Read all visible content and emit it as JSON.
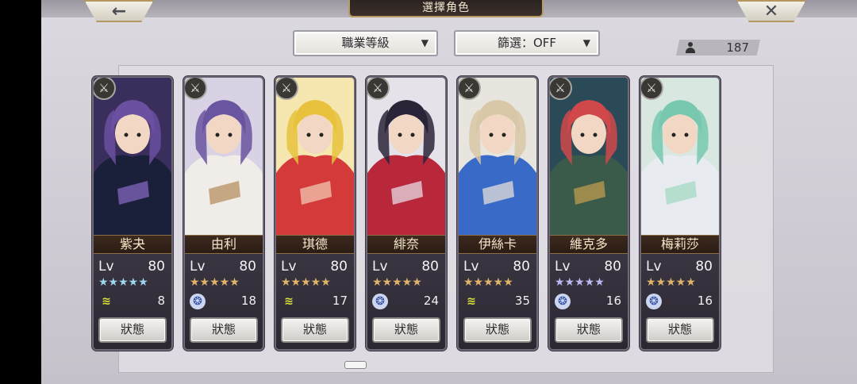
{
  "header": {
    "title": "選擇角色",
    "back_icon": "←",
    "close_icon": "✕"
  },
  "toolbar": {
    "sort_label": "職業等級",
    "filter_label": "篩選：OFF",
    "dropdown_arrow": "▼",
    "character_count": "187"
  },
  "characters": [
    {
      "name": "紫夬",
      "lv_label": "Lv",
      "level": "80",
      "stars": "★★★★★",
      "star_color": "#9ad6f0",
      "weapon": "wind",
      "weapon_glyph": "≋",
      "weapon_value": "8",
      "status_label": "狀態"
    },
    {
      "name": "由利",
      "lv_label": "Lv",
      "level": "80",
      "stars": "★★★★★",
      "star_color": "#e0b36a",
      "weapon": "swirl",
      "weapon_glyph": "❂",
      "weapon_value": "18",
      "status_label": "狀態"
    },
    {
      "name": "琪德",
      "lv_label": "Lv",
      "level": "80",
      "stars": "★★★★★",
      "star_color": "#e0b36a",
      "weapon": "wind",
      "weapon_glyph": "≋",
      "weapon_value": "17",
      "status_label": "狀態"
    },
    {
      "name": "緋奈",
      "lv_label": "Lv",
      "level": "80",
      "stars": "★★★★★",
      "star_color": "#e0b36a",
      "weapon": "swirl",
      "weapon_glyph": "❂",
      "weapon_value": "24",
      "status_label": "狀態"
    },
    {
      "name": "伊絲卡",
      "lv_label": "Lv",
      "level": "80",
      "stars": "★★★★★",
      "star_color": "#e0b36a",
      "weapon": "wind",
      "weapon_glyph": "≋",
      "weapon_value": "35",
      "status_label": "狀態"
    },
    {
      "name": "維克多",
      "lv_label": "Lv",
      "level": "80",
      "stars": "★★★★★",
      "star_color": "#b9b8f0",
      "weapon": "swirl",
      "weapon_glyph": "❂",
      "weapon_value": "16",
      "status_label": "狀態"
    },
    {
      "name": "梅莉莎",
      "lv_label": "Lv",
      "level": "80",
      "stars": "★★★★★",
      "star_color": "#e0b36a",
      "weapon": "swirl",
      "weapon_glyph": "❂",
      "weapon_value": "16",
      "status_label": "狀態"
    }
  ],
  "class_badge_glyph": "⚔"
}
